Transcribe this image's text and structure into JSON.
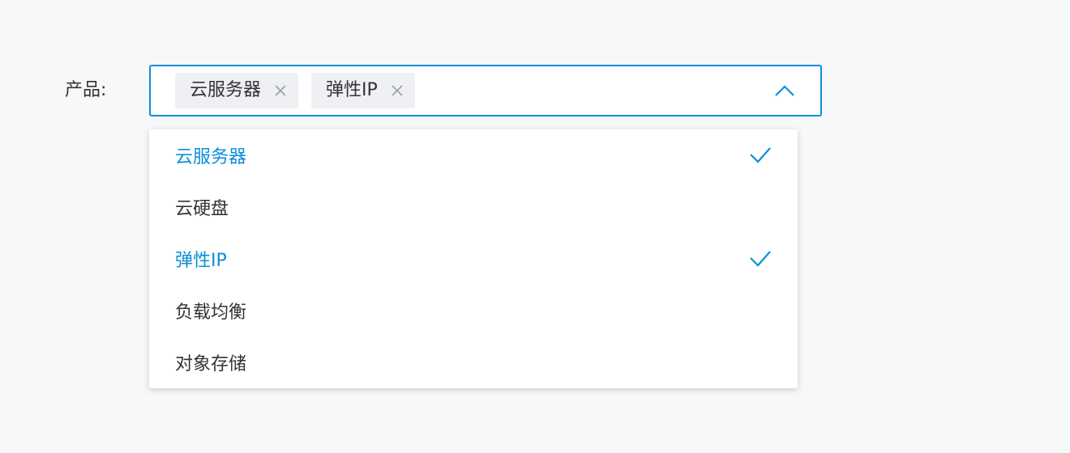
{
  "form": {
    "label": "产品:"
  },
  "select": {
    "tags": [
      {
        "label": "云服务器"
      },
      {
        "label": "弹性IP"
      }
    ]
  },
  "dropdown": {
    "options": [
      {
        "label": "云服务器",
        "selected": true
      },
      {
        "label": "云硬盘",
        "selected": false
      },
      {
        "label": "弹性IP",
        "selected": true
      },
      {
        "label": "负载均衡",
        "selected": false
      },
      {
        "label": "对象存储",
        "selected": false
      }
    ]
  },
  "colors": {
    "accent": "#0b8fd6",
    "tag_bg": "#eef0f4",
    "text": "#333333",
    "page_bg": "#f7f8fa"
  },
  "icons": {
    "tag_remove": "close-icon",
    "toggle": "chevron-up-icon",
    "selected": "check-icon"
  }
}
